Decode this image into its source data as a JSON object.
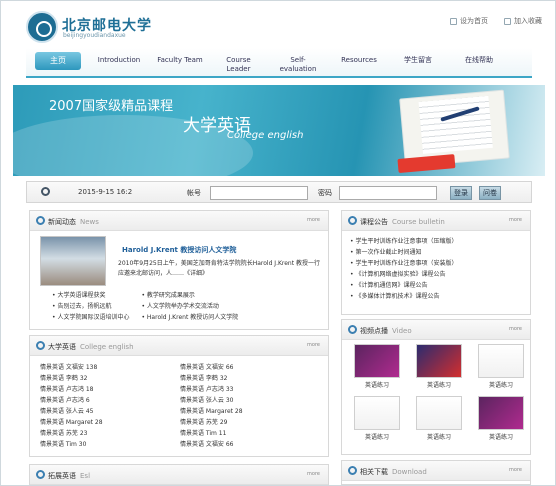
{
  "header": {
    "logo_cn": "北京邮电大学",
    "logo_en": "beijingyoudiandaxue",
    "links": [
      "设为首页",
      "加入收藏"
    ]
  },
  "nav": [
    "主页",
    "Introduction",
    "Faculty Team",
    "Course\nLeader",
    "Self-\nevaluation",
    "Resources",
    "学生留言",
    "在线帮助"
  ],
  "banner": {
    "title": "2007国家级精品课程",
    "subtitle": "大学英语",
    "english": "College english"
  },
  "login": {
    "datetime": "2015-9-15 16:2",
    "account_label": "帐号",
    "password_label": "密码",
    "login_btn": "登录",
    "register_btn": "问卷"
  },
  "news": {
    "title": "新闻动态",
    "sub": "News",
    "more": "more",
    "headline": "Harold J.Krent 教授访问人文学院",
    "text": "2010年9月25日上午，美国芝加哥肯特法学院院长Harold J.Krent 教授一行应邀来北邮访问，人……《详细》",
    "items": [
      [
        "大学英语课程获奖",
        "教学研究成果展示"
      ],
      [
        "告别过去，扬帆远航",
        "人文学院举办学术交流活动"
      ],
      [
        "人文学院国际汉语培训中心",
        "Harold J.Krent 教授访问人文学院"
      ]
    ]
  },
  "college": {
    "title": "大学英语",
    "sub": "College english",
    "more": "more",
    "rows": [
      [
        "情景英语 文福安 138",
        "情景英语 文福安 66"
      ],
      [
        "情景英语 李鹤 32",
        "情景英语 李鹤 32"
      ],
      [
        "情景英语 卢志鸿 18",
        "情景英语 卢志鸿 33"
      ],
      [
        "情景英语 卢志鸿 6",
        "情景英语 张人云 30"
      ],
      [
        "情景英语 张人云 45",
        "情景英语 Margaret 28"
      ],
      [
        "情景英语 Margaret 28",
        "情景英语 苏芜 29"
      ],
      [
        "情景英语 苏芜 23",
        "情景英语 Tim 11"
      ],
      [
        "情景英语 Tim 30",
        "情景英语 文福安 66"
      ]
    ]
  },
  "esl": {
    "title": "拓展英语",
    "sub": "Esl",
    "more": "more"
  },
  "bulletin": {
    "title": "课程公告",
    "sub": "Course bulletin",
    "more": "more",
    "items": [
      "学生平时训练作业注意事项（压缩版）",
      "第一次作业截止时间通知",
      "学生平时训练作业注意事项（安装版）",
      "《计算机网络虚拟实验》课程公告",
      "《计算机通信网》课程公告",
      "《多媒体计算机技术》课程公告"
    ]
  },
  "video": {
    "title": "视频点播",
    "sub": "Video",
    "more": "more",
    "items": [
      "英语练习",
      "英语练习",
      "英语练习",
      "英语练习",
      "英语练习",
      "英语练习"
    ]
  },
  "download": {
    "title": "相关下载",
    "sub": "Download",
    "more": "more"
  }
}
